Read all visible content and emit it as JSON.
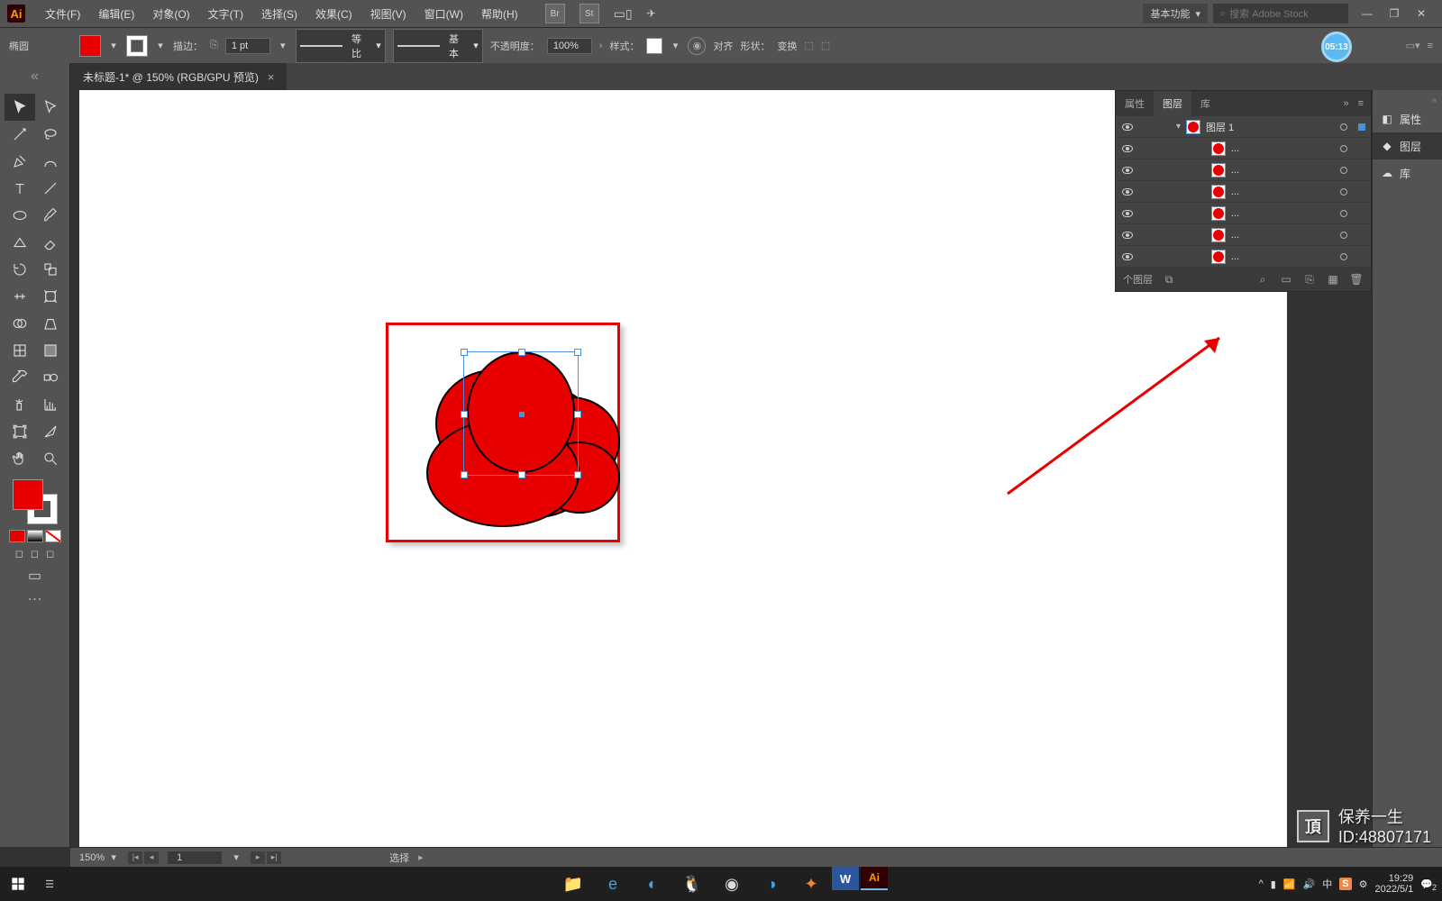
{
  "app": {
    "logo_text": "Ai"
  },
  "menu": [
    "文件(F)",
    "编辑(E)",
    "对象(O)",
    "文字(T)",
    "选择(S)",
    "效果(C)",
    "视图(V)",
    "窗口(W)",
    "帮助(H)"
  ],
  "menubar_icons": [
    "Br",
    "St"
  ],
  "workspace": {
    "label": "基本功能"
  },
  "search": {
    "placeholder": "搜索 Adobe Stock"
  },
  "options": {
    "tool_name": "椭圆",
    "stroke_label": "描边：",
    "stroke_weight": "1 pt",
    "profile_label": "等比",
    "brush_label": "基本",
    "opacity_label": "不透明度：",
    "opacity_value": "100%",
    "style_label": "样式：",
    "align_label": "对齐",
    "shape_label": "形状：",
    "transform_label": "变换"
  },
  "tab": {
    "title": "未标题-1* @ 150% (RGB/GPU 预览)"
  },
  "timer": "05:13",
  "right_strip": [
    {
      "label": "属性",
      "active": false
    },
    {
      "label": "图层",
      "active": true
    },
    {
      "label": "库",
      "active": false
    }
  ],
  "layers_panel": {
    "tabs": [
      "属性",
      "图层",
      "库"
    ],
    "active_tab": "图层",
    "top_layer": "图层 1",
    "sub_label": "...",
    "footer_label": "个图层",
    "sublayers_count": 6
  },
  "status": {
    "zoom": "150%",
    "artboard_num": "1",
    "tool_state": "选择"
  },
  "taskbar": {
    "time": "19:29",
    "date": "2022/5/1",
    "ime": "中",
    "notif": "2"
  },
  "watermark": {
    "icon": "頂",
    "line1": "保养一生",
    "line2": "ID:48807171"
  }
}
